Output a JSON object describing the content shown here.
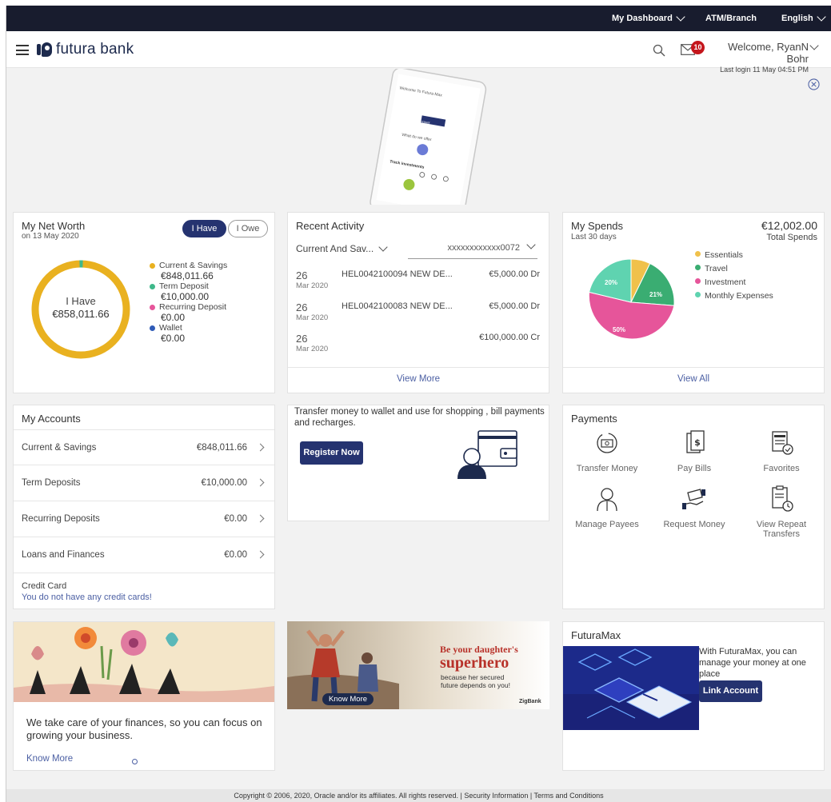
{
  "topbar": {
    "dashboard": "My Dashboard",
    "atm": "ATM/Branch",
    "language": "English"
  },
  "header": {
    "logo_text": "futura bank",
    "notification_count": "10",
    "welcome": "Welcome, RyanN Bohr",
    "last_login": "Last login 11 May 04:51 PM"
  },
  "banner": {
    "phone_title": "Welcome To Futura Max",
    "phone_button": "Link Account",
    "phone_offer": "What do we offer",
    "phone_track": "Track investments"
  },
  "networth": {
    "title": "My Net Worth",
    "date": "on 13 May 2020",
    "toggle_have": "I Have",
    "toggle_owe": "I Owe",
    "center_label": "I Have",
    "center_value": "€858,011.66",
    "items": [
      {
        "label": "Current & Savings",
        "value": "€848,011.66",
        "color": "#e9b120"
      },
      {
        "label": "Term Deposit",
        "value": "€10,000.00",
        "color": "#3fb88a"
      },
      {
        "label": "Recurring Deposit",
        "value": "€0.00",
        "color": "#e6559a"
      },
      {
        "label": "Wallet",
        "value": "€0.00",
        "color": "#2f5bb7"
      }
    ]
  },
  "activity": {
    "title": "Recent Activity",
    "account_type": "Current And Sav...",
    "account_number": "xxxxxxxxxxxx0072",
    "rows": [
      {
        "day": "26",
        "mon": "Mar 2020",
        "desc": "HEL0042100094 NEW DE...",
        "amount": "€5,000.00 Dr"
      },
      {
        "day": "26",
        "mon": "Mar 2020",
        "desc": "HEL0042100083 NEW DE...",
        "amount": "€5,000.00 Dr"
      },
      {
        "day": "26",
        "mon": "Mar 2020",
        "desc": "",
        "amount": "€100,000.00 Cr"
      }
    ],
    "view_more": "View More"
  },
  "spends": {
    "title": "My Spends",
    "period": "Last 30 days",
    "total": "€12,002.00",
    "total_label": "Total Spends",
    "legend": [
      {
        "label": "Essentials",
        "color": "#f0c14b"
      },
      {
        "label": "Travel",
        "color": "#3aad72"
      },
      {
        "label": "Investment",
        "color": "#e6559a"
      },
      {
        "label": "Monthly Expenses",
        "color": "#5fd3b0"
      }
    ],
    "slice_labels": [
      "21%",
      "50%",
      "20%"
    ],
    "view_all": "View All"
  },
  "accounts": {
    "title": "My Accounts",
    "rows": [
      {
        "name": "Current & Savings",
        "amount": "€848,011.66"
      },
      {
        "name": "Term Deposits",
        "amount": "€10,000.00"
      },
      {
        "name": "Recurring Deposits",
        "amount": "€0.00"
      },
      {
        "name": "Loans and Finances",
        "amount": "€0.00"
      }
    ],
    "credit_card_label": "Credit Card",
    "credit_card_note": "You do not have any credit cards!"
  },
  "wallet_promo": {
    "text": "Transfer money to wallet and use for shopping , bill payments and recharges.",
    "button": "Register Now"
  },
  "payments": {
    "title": "Payments",
    "items": [
      {
        "label": "Transfer Money",
        "icon": "transfer-money-icon"
      },
      {
        "label": "Pay Bills",
        "icon": "pay-bills-icon"
      },
      {
        "label": "Favorites",
        "icon": "favorites-icon"
      },
      {
        "label": "Manage Payees",
        "icon": "manage-payees-icon"
      },
      {
        "label": "Request Money",
        "icon": "request-money-icon"
      },
      {
        "label": "View Repeat Transfers",
        "icon": "repeat-transfers-icon"
      }
    ]
  },
  "promo_finance": {
    "text": "We take care of your finances, so you can focus on growing your business.",
    "link": "Know More"
  },
  "promo_daughter": {
    "headline1": "Be your daughter's",
    "headline2": "superhero",
    "sub": "because her secured future depends on you!",
    "button": "Know More",
    "brand": "ZigBank"
  },
  "futuramax": {
    "title": "FuturaMax",
    "text": "With FuturaMax, you can manage your money at one place",
    "button": "Link Account"
  },
  "footer": {
    "text": "Copyright © 2006, 2020, Oracle and/or its affiliates. All rights reserved. | Security Information | Terms and Conditions"
  }
}
